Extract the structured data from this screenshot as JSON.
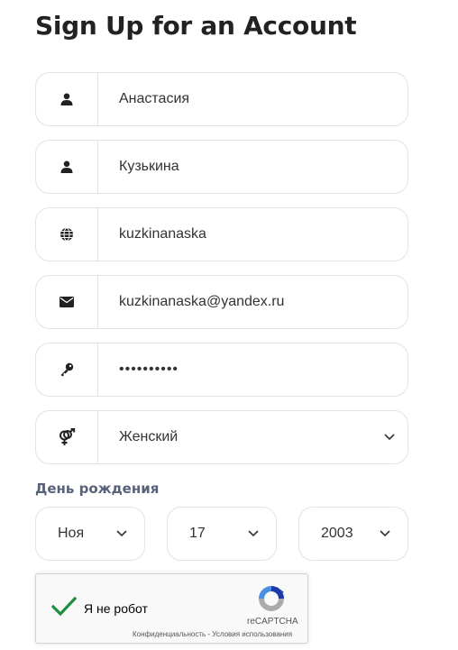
{
  "page": {
    "title": "Sign Up for an Account"
  },
  "form": {
    "first_name": {
      "value": "Анастасия",
      "icon": "user-icon"
    },
    "last_name": {
      "value": "Кузькина",
      "icon": "user-icon"
    },
    "username": {
      "value": "kuzkinanaska",
      "icon": "globe-icon"
    },
    "email": {
      "value": "kuzkinanaska@yandex.ru",
      "icon": "envelope-icon"
    },
    "password": {
      "value": "••••••••••",
      "icon": "key-icon"
    },
    "gender": {
      "value": "Женский",
      "icon": "gender-icon"
    }
  },
  "dob": {
    "label": "День рождения",
    "month": "Ноя",
    "day": "17",
    "year": "2003"
  },
  "recaptcha": {
    "label": "Я не робот",
    "brand": "reCAPTCHA",
    "terms": "Конфиденциальность - Условия использования",
    "checked": true,
    "check_color": "#1e8e3e"
  }
}
